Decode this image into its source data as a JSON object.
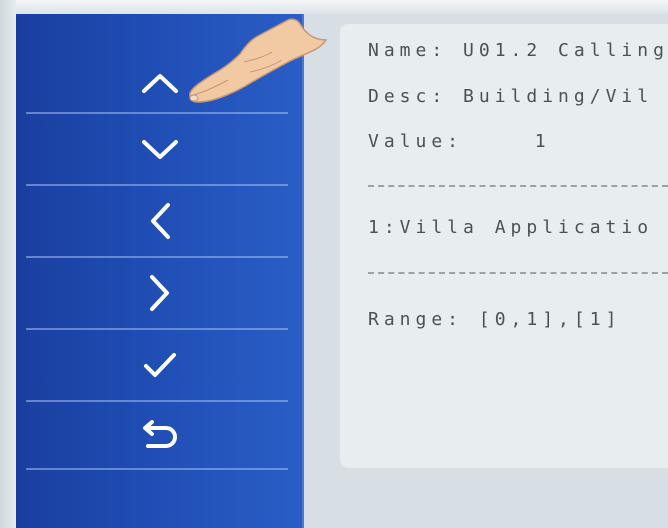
{
  "nav": {
    "buttons": [
      {
        "name": "up",
        "icon": "chevron-up-icon"
      },
      {
        "name": "down",
        "icon": "chevron-down-icon"
      },
      {
        "name": "left",
        "icon": "chevron-left-icon"
      },
      {
        "name": "right",
        "icon": "chevron-right-icon"
      },
      {
        "name": "confirm",
        "icon": "check-icon"
      },
      {
        "name": "back",
        "icon": "return-icon"
      }
    ]
  },
  "param": {
    "name_label": "Name:",
    "name_value": "U01.2 Calling",
    "desc_label": "Desc:",
    "desc_value": "Building/Vil",
    "value_label": "Value:",
    "value_value": "1",
    "option": "1:Villa Applicatio",
    "range_label": "Range:",
    "range_value": "[0,1],[1]"
  },
  "colors": {
    "sidebar": "#1f4db4",
    "content_bg": "#e8edf0",
    "text": "#4a5258"
  }
}
